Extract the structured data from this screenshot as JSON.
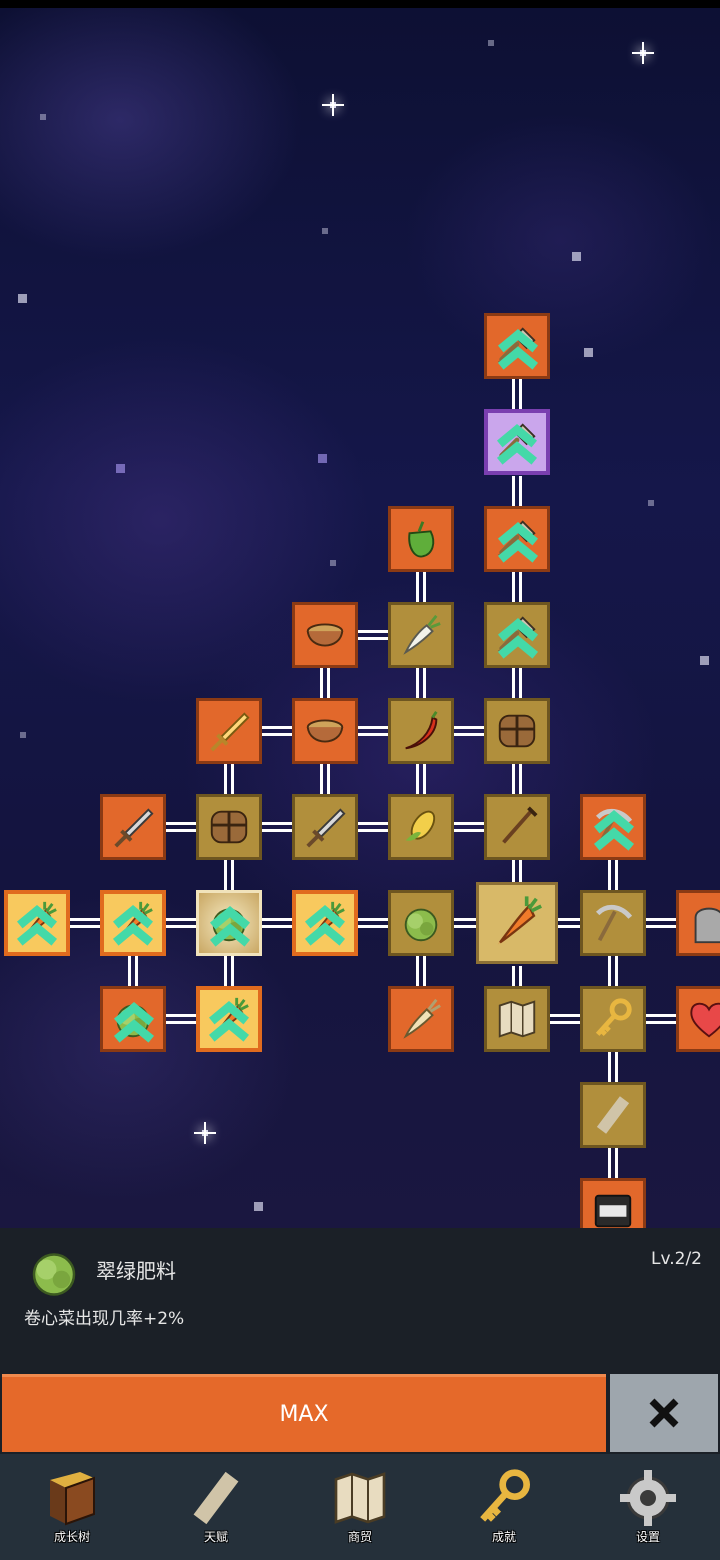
{
  "skill_tree": {
    "nodes": [
      {
        "id": "shovel-top",
        "icon": "shovel-icon",
        "style": "orange"
      },
      {
        "id": "shovel-purple",
        "icon": "shovel-icon",
        "style": "purple"
      },
      {
        "id": "bell-pepper",
        "icon": "bell-pepper-icon",
        "style": "orange"
      },
      {
        "id": "shovel-3",
        "icon": "shovel-icon",
        "style": "orange"
      },
      {
        "id": "wooden-bowl-1",
        "icon": "wooden-bowl-icon",
        "style": "orange"
      },
      {
        "id": "daikon-radish",
        "icon": "daikon-radish-icon",
        "style": "tan"
      },
      {
        "id": "shovel-4",
        "icon": "shovel-icon",
        "style": "tan"
      },
      {
        "id": "golden-sword",
        "icon": "golden-sword-icon",
        "style": "orange"
      },
      {
        "id": "wooden-bowl-2",
        "icon": "wooden-bowl-icon",
        "style": "orange"
      },
      {
        "id": "chili-pepper",
        "icon": "chili-pepper-icon",
        "style": "tan"
      },
      {
        "id": "chest",
        "icon": "chest-icon",
        "style": "tan"
      },
      {
        "id": "sword-1",
        "icon": "sword-icon",
        "style": "orange"
      },
      {
        "id": "chest-2",
        "icon": "chest-icon",
        "style": "tan"
      },
      {
        "id": "sword-2",
        "icon": "sword-icon",
        "style": "tan"
      },
      {
        "id": "corn",
        "icon": "corn-icon",
        "style": "tan"
      },
      {
        "id": "rake",
        "icon": "rake-icon",
        "style": "tan"
      },
      {
        "id": "pickaxe-1",
        "icon": "pickaxe-icon",
        "style": "orange"
      },
      {
        "id": "carrot-left",
        "icon": "carrot-icon",
        "style": "yellow"
      },
      {
        "id": "carrot-2",
        "icon": "carrot-icon",
        "style": "yellow"
      },
      {
        "id": "cabbage-selected",
        "icon": "cabbage-icon",
        "style": "sel"
      },
      {
        "id": "carrot-4",
        "icon": "carrot-icon",
        "style": "yellow"
      },
      {
        "id": "cabbage-2",
        "icon": "cabbage-icon",
        "style": "tan"
      },
      {
        "id": "carrot-center",
        "icon": "carrot-icon",
        "style": "big"
      },
      {
        "id": "pickaxe-2",
        "icon": "pickaxe-icon",
        "style": "tan"
      },
      {
        "id": "tombstone",
        "icon": "tombstone-icon",
        "style": "orange"
      },
      {
        "id": "cabbage-3",
        "icon": "cabbage-icon",
        "style": "orange"
      },
      {
        "id": "carrot-5",
        "icon": "carrot-icon",
        "style": "yellow"
      },
      {
        "id": "parsnip",
        "icon": "parsnip-icon",
        "style": "orange"
      },
      {
        "id": "map",
        "icon": "map-icon",
        "style": "tan"
      },
      {
        "id": "golden-key",
        "icon": "key-icon",
        "style": "tan"
      },
      {
        "id": "heart",
        "icon": "heart-icon",
        "style": "orange"
      },
      {
        "id": "scroll",
        "icon": "scroll-icon",
        "style": "tan"
      },
      {
        "id": "cash-register",
        "icon": "cash-register-icon",
        "style": "orange"
      }
    ]
  },
  "info_panel": {
    "icon": "cabbage-icon",
    "title": "翠绿肥料",
    "level": "Lv.2/2",
    "description": "卷心菜出现几率+2%",
    "max_label": "MAX",
    "close_icon": "close-icon"
  },
  "nav": {
    "items": [
      {
        "label": "成长树",
        "icon": "book-icon"
      },
      {
        "label": "天赋",
        "icon": "scroll-icon"
      },
      {
        "label": "商贸",
        "icon": "map-icon"
      },
      {
        "label": "成就",
        "icon": "key-icon"
      },
      {
        "label": "设置",
        "icon": "gear-icon"
      }
    ]
  },
  "colors": {
    "node_orange": "#e2682b",
    "node_tan": "#b18f3c",
    "node_yellow": "#f8c95e",
    "node_purple": "#caa6ec",
    "max_button": "#e5692a",
    "close_button": "#9ea6ad",
    "panel_bg": "#1b2027",
    "nav_bg": "#25303a"
  }
}
